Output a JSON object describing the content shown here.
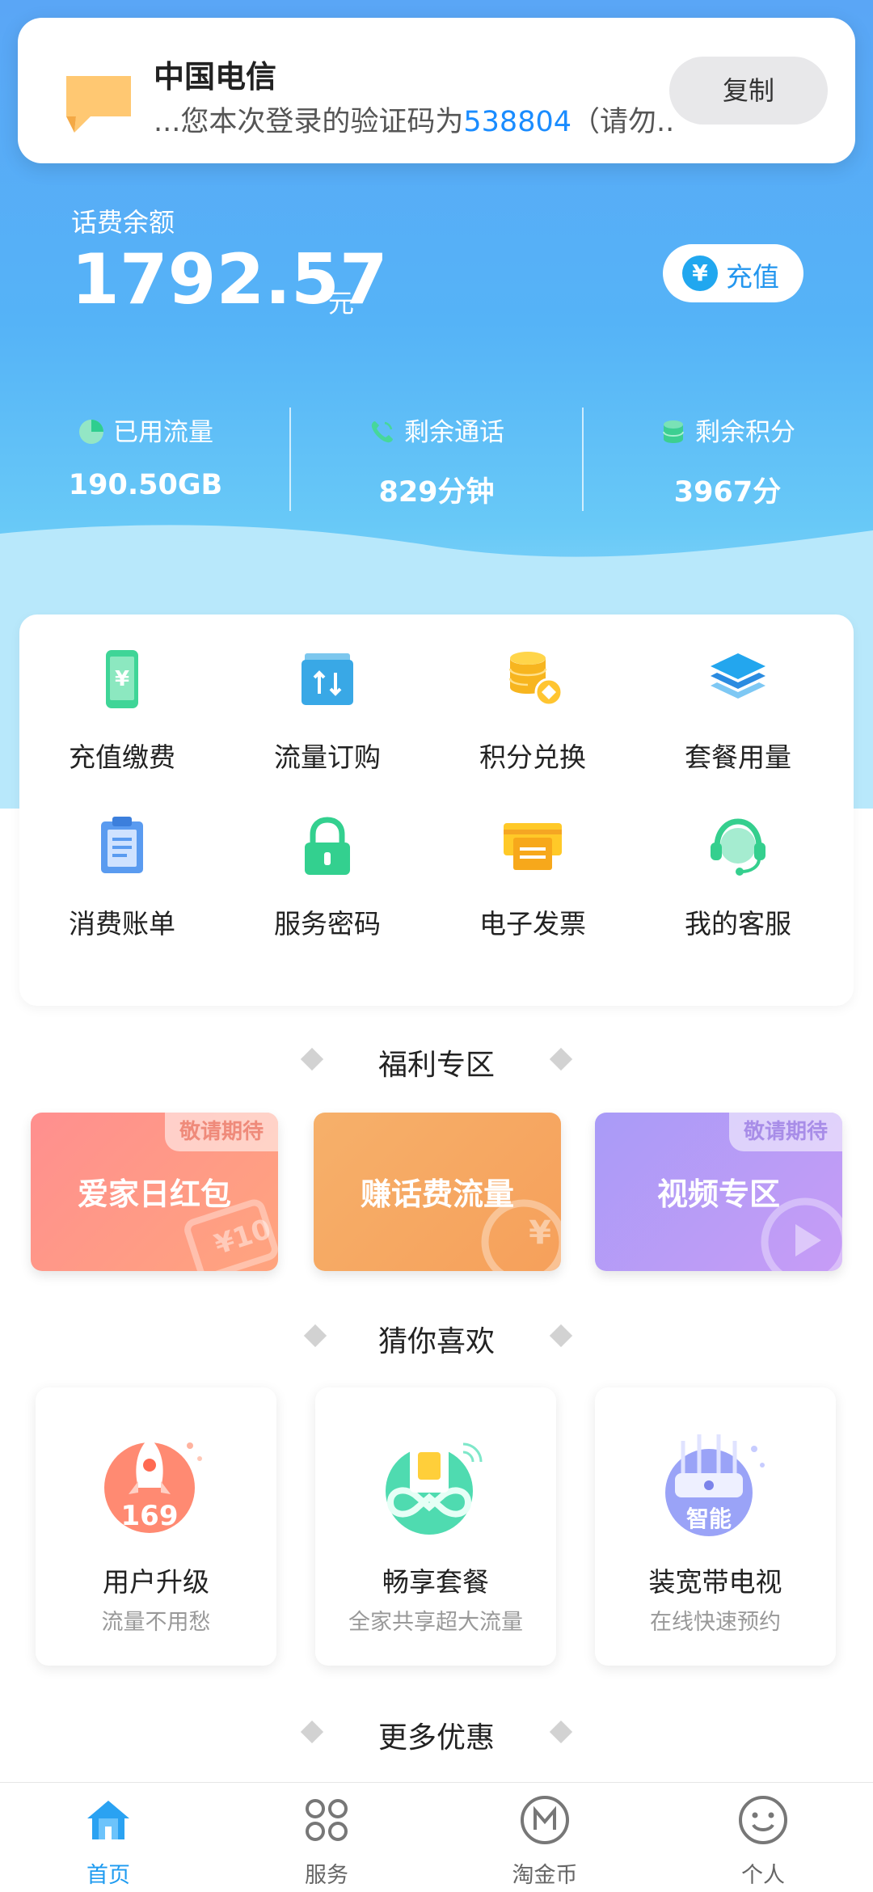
{
  "notification": {
    "app": "中国电信",
    "body_prefix": "...您本次登录的验证码为",
    "code": "538804",
    "body_suffix": "（请勿..",
    "copy_label": "复制"
  },
  "balance": {
    "label": "话费余额",
    "amount": "1792.57",
    "unit": "元",
    "recharge_label": "充值"
  },
  "stats": [
    {
      "label": "已用流量",
      "value": "190.50GB",
      "icon": "pie-chart-icon"
    },
    {
      "label": "剩余通话",
      "value": "829分钟",
      "icon": "phone-icon"
    },
    {
      "label": "剩余积分",
      "value": "3967分",
      "icon": "coin-stack-icon"
    }
  ],
  "services": [
    {
      "label": "充值缴费",
      "icon": "phone-yen-icon"
    },
    {
      "label": "流量订购",
      "icon": "data-order-icon"
    },
    {
      "label": "积分兑换",
      "icon": "coins-exchange-icon"
    },
    {
      "label": "套餐用量",
      "icon": "layers-icon"
    },
    {
      "label": "消费账单",
      "icon": "clipboard-bill-icon"
    },
    {
      "label": "服务密码",
      "icon": "lock-icon"
    },
    {
      "label": "电子发票",
      "icon": "invoice-icon"
    },
    {
      "label": "我的客服",
      "icon": "headset-icon"
    }
  ],
  "welfare": {
    "title": "福利专区",
    "cards": [
      {
        "title": "爱家日红包",
        "tag": "敬请期待",
        "badge": "¥10"
      },
      {
        "title": "赚话费流量",
        "tag": "",
        "badge": "¥"
      },
      {
        "title": "视频专区",
        "tag": "敬请期待",
        "badge": ""
      }
    ]
  },
  "recommend": {
    "title": "猜你喜欢",
    "cards": [
      {
        "title": "用户升级",
        "subtitle": "流量不用愁",
        "art_text": "169"
      },
      {
        "title": "畅享套餐",
        "subtitle": "全家共享超大流量",
        "art_text": ""
      },
      {
        "title": "装宽带电视",
        "subtitle": "在线快速预约",
        "art_text": "智能"
      }
    ]
  },
  "more": {
    "title": "更多优惠"
  },
  "tabs": [
    {
      "label": "首页",
      "icon": "home-icon",
      "active": true
    },
    {
      "label": "服务",
      "icon": "grid-circles-icon",
      "active": false
    },
    {
      "label": "淘金币",
      "icon": "m-coin-icon",
      "active": false
    },
    {
      "label": "个人",
      "icon": "smiley-icon",
      "active": false
    }
  ],
  "colors": {
    "accent": "#1e9bf0",
    "code_blue": "#1a8cff",
    "hero_top": "#5aa6f6"
  }
}
